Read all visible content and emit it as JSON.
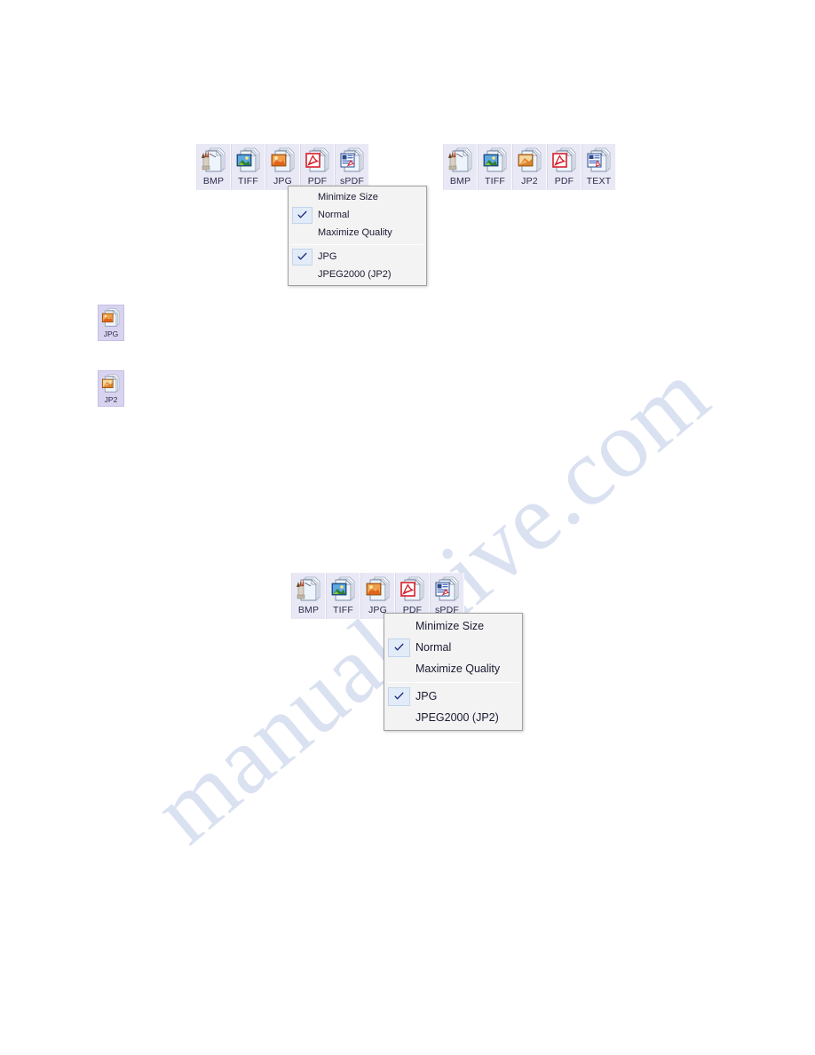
{
  "watermark": {
    "text": "manualshive.com",
    "color": "#ccd6ec"
  },
  "format_bars": [
    {
      "id": "bar-top-left",
      "buttons": [
        {
          "label": "BMP",
          "icon": "bmp-format-icon"
        },
        {
          "label": "TIFF",
          "icon": "tiff-format-icon"
        },
        {
          "label": "JPG",
          "icon": "jpg-format-icon"
        },
        {
          "label": "PDF",
          "icon": "pdf-format-icon"
        },
        {
          "label": "sPDF",
          "icon": "spdf-format-icon"
        }
      ]
    },
    {
      "id": "bar-top-right",
      "buttons": [
        {
          "label": "BMP",
          "icon": "bmp-format-icon"
        },
        {
          "label": "TIFF",
          "icon": "tiff-format-icon"
        },
        {
          "label": "JP2",
          "icon": "jp2-format-icon"
        },
        {
          "label": "PDF",
          "icon": "pdf-format-icon"
        },
        {
          "label": "TEXT",
          "icon": "text-format-icon"
        }
      ]
    },
    {
      "id": "bar-bottom",
      "buttons": [
        {
          "label": "BMP",
          "icon": "bmp-format-icon"
        },
        {
          "label": "TIFF",
          "icon": "tiff-format-icon"
        },
        {
          "label": "JPG",
          "icon": "jpg-format-icon"
        },
        {
          "label": "PDF",
          "icon": "pdf-format-icon"
        },
        {
          "label": "sPDF",
          "icon": "spdf-format-icon"
        }
      ]
    }
  ],
  "solo_icons": [
    {
      "label": "JPG",
      "icon": "jpg-format-icon"
    },
    {
      "label": "JP2",
      "icon": "jp2-format-icon"
    }
  ],
  "context_menus": [
    {
      "id": "menu-top",
      "group_quality": [
        {
          "label": "Minimize Size",
          "checked": false
        },
        {
          "label": "Normal",
          "checked": true
        },
        {
          "label": "Maximize Quality",
          "checked": false
        }
      ],
      "group_format": [
        {
          "label": "JPG",
          "checked": true
        },
        {
          "label": "JPEG2000 (JP2)",
          "checked": false
        }
      ]
    },
    {
      "id": "menu-bottom",
      "group_quality": [
        {
          "label": "Minimize Size",
          "checked": false
        },
        {
          "label": "Normal",
          "checked": true
        },
        {
          "label": "Maximize Quality",
          "checked": false
        }
      ],
      "group_format": [
        {
          "label": "JPG",
          "checked": true
        },
        {
          "label": "JPEG2000 (JP2)",
          "checked": false
        }
      ]
    }
  ],
  "icons": {
    "checkmark": "check-icon"
  }
}
